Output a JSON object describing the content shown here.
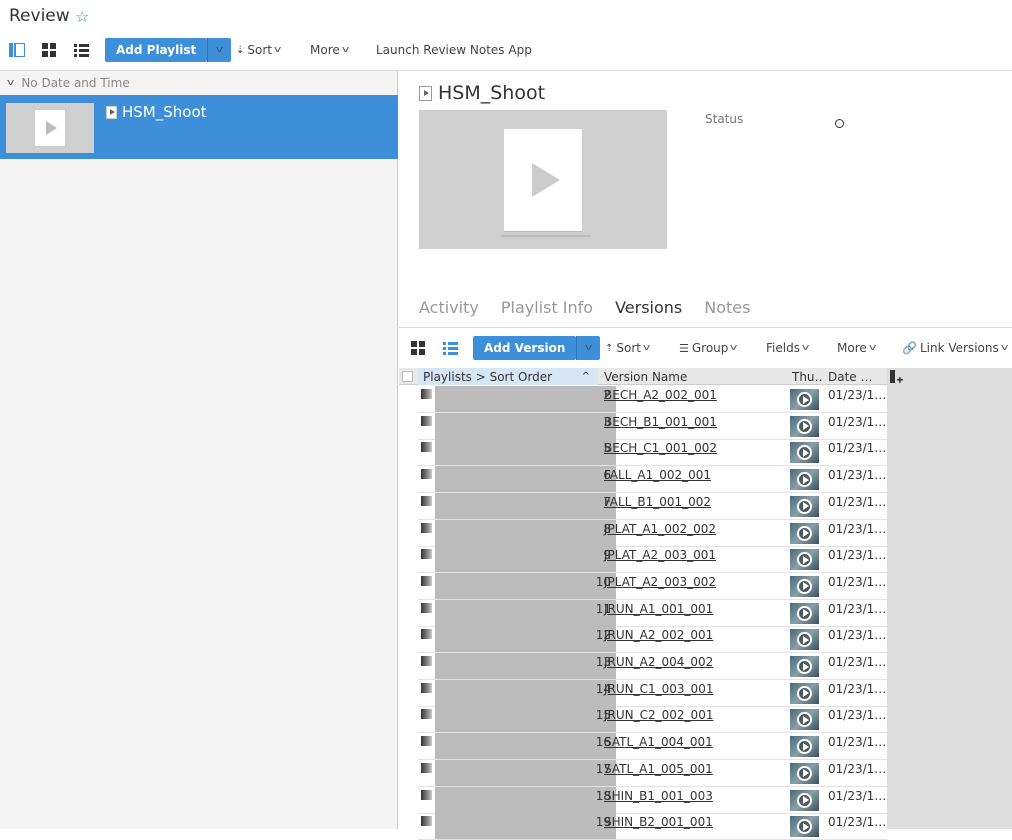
{
  "page": {
    "title": "Review"
  },
  "toolbar": {
    "add_playlist": "Add Playlist",
    "sort": "Sort",
    "more": "More",
    "launch": "Launch Review Notes App"
  },
  "left": {
    "group_header": "No Date and Time",
    "selected_item": "HSM_Shoot"
  },
  "detail": {
    "title": "HSM_Shoot",
    "status_label": "Status",
    "tabs": [
      "Activity",
      "Playlist Info",
      "Versions",
      "Notes"
    ],
    "active_tab": "Versions"
  },
  "versions_toolbar": {
    "add_version": "Add Version",
    "sort": "Sort",
    "group": "Group",
    "fields": "Fields",
    "more": "More",
    "link_versions": "Link Versions"
  },
  "table": {
    "columns": [
      "Playlists > Sort Order",
      "Version Name",
      "Thu…",
      "Date …"
    ],
    "rows": [
      {
        "order": "2",
        "name": "BECH_A2_002_001",
        "date": "01/23/1…"
      },
      {
        "order": "3",
        "name": "BECH_B1_001_001",
        "date": "01/23/1…"
      },
      {
        "order": "5",
        "name": "BECH_C1_001_002",
        "date": "01/23/1…"
      },
      {
        "order": "6",
        "name": "FALL_A1_002_001",
        "date": "01/23/1…"
      },
      {
        "order": "7",
        "name": "FALL_B1_001_002",
        "date": "01/23/1…"
      },
      {
        "order": "8",
        "name": "JPLAT_A1_002_002",
        "date": "01/23/1…"
      },
      {
        "order": "9",
        "name": "JPLAT_A2_003_001",
        "date": "01/23/1…"
      },
      {
        "order": "10",
        "name": "JPLAT_A2_003_002",
        "date": "01/23/1…"
      },
      {
        "order": "11",
        "name": "JRUN_A1_001_001",
        "date": "01/23/1…"
      },
      {
        "order": "12",
        "name": "JRUN_A2_002_001",
        "date": "01/23/1…"
      },
      {
        "order": "13",
        "name": "JRUN_A2_004_002",
        "date": "01/23/1…"
      },
      {
        "order": "14",
        "name": "JRUN_C1_003_001",
        "date": "01/23/1…"
      },
      {
        "order": "15",
        "name": "JRUN_C2_002_001",
        "date": "01/23/1…"
      },
      {
        "order": "16",
        "name": "SATL_A1_004_001",
        "date": "01/23/1…"
      },
      {
        "order": "17",
        "name": "SATL_A1_005_001",
        "date": "01/23/1…"
      },
      {
        "order": "18",
        "name": "SHIN_B1_001_003",
        "date": "01/23/1…"
      },
      {
        "order": "19",
        "name": "SHIN_B2_001_001",
        "date": "01/23/1…"
      }
    ]
  }
}
